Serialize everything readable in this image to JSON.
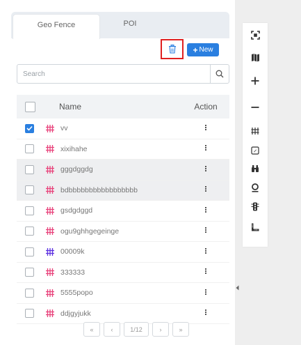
{
  "tabs": [
    {
      "label": "Geo Fence",
      "active": true
    },
    {
      "label": "POI",
      "active": false
    }
  ],
  "toolbar": {
    "new_label": "New"
  },
  "search": {
    "placeholder": "Search"
  },
  "table": {
    "columns": [
      "Name",
      "Action"
    ],
    "rows": [
      {
        "name": "vv",
        "checked": true,
        "icon_color": "#e8417a"
      },
      {
        "name": "xixihahe",
        "checked": false,
        "icon_color": "#e8417a"
      },
      {
        "name": "gggdggdg",
        "checked": false,
        "icon_color": "#e8417a"
      },
      {
        "name": "bdbbbbbbbbbbbbbbbbb",
        "checked": false,
        "icon_color": "#e8417a"
      },
      {
        "name": "gsdgdggd",
        "checked": false,
        "icon_color": "#e8417a"
      },
      {
        "name": "ogu9ghhgegeinge",
        "checked": false,
        "icon_color": "#e8417a"
      },
      {
        "name": "00009k",
        "checked": false,
        "icon_color": "#5b2ee0"
      },
      {
        "name": "333333",
        "checked": false,
        "icon_color": "#e8417a"
      },
      {
        "name": "5555popo",
        "checked": false,
        "icon_color": "#e8417a"
      },
      {
        "name": "ddjgyjukk",
        "checked": false,
        "icon_color": "#e8417a"
      }
    ]
  },
  "pagination": {
    "first": "«",
    "prev": "‹",
    "info": "1/12",
    "next": "›",
    "last": "»"
  },
  "colors": {
    "primary": "#2a7fe0",
    "danger": "#e02020",
    "fence_icon": "#e8417a"
  },
  "map_tools": [
    "fullscreen-icon",
    "map-layers-icon",
    "zoom-in-icon",
    "zoom-out-icon",
    "fence-icon",
    "note-icon",
    "binoculars-icon",
    "location-pin-icon",
    "traffic-light-icon",
    "ruler-icon"
  ]
}
